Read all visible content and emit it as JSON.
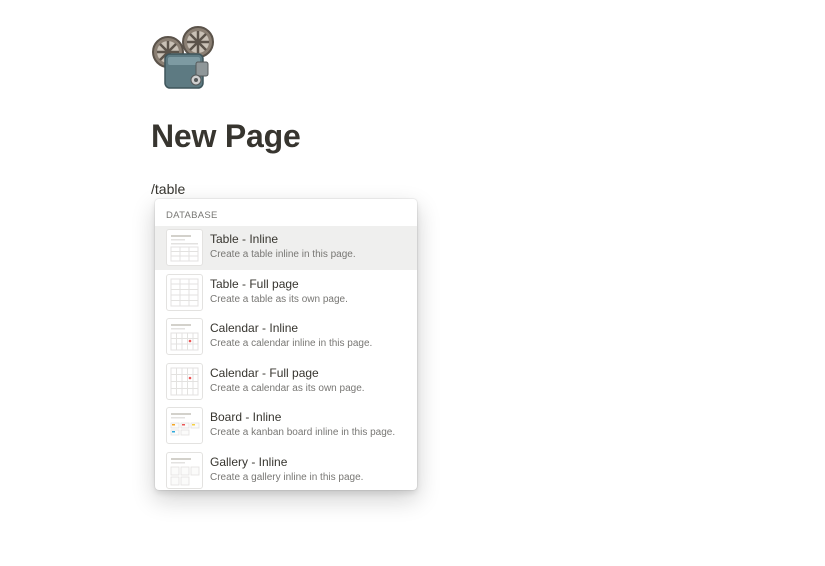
{
  "page": {
    "icon": "film-projector-icon",
    "title": "New Page",
    "editor_line": "/table"
  },
  "menu": {
    "section_label": "DATABASE",
    "items": [
      {
        "title": "Table - Inline",
        "description": "Create a table inline in this page.",
        "icon": "table-inline-thumbnail",
        "selected": true
      },
      {
        "title": "Table - Full page",
        "description": "Create a table as its own page.",
        "icon": "table-full-page-thumbnail",
        "selected": false
      },
      {
        "title": "Calendar - Inline",
        "description": "Create a calendar inline in this page.",
        "icon": "calendar-inline-thumbnail",
        "selected": false
      },
      {
        "title": "Calendar - Full page",
        "description": "Create a calendar as its own page.",
        "icon": "calendar-full-page-thumbnail",
        "selected": false
      },
      {
        "title": "Board - Inline",
        "description": "Create a kanban board inline in this page.",
        "icon": "board-inline-thumbnail",
        "selected": false
      },
      {
        "title": "Gallery - Inline",
        "description": "Create a gallery inline in this page.",
        "icon": "gallery-inline-thumbnail",
        "selected": false
      }
    ]
  },
  "colors": {
    "text": "#37352f",
    "muted": "#787774",
    "selected_bg": "#efefee",
    "calendar_dot": "#eb5757"
  }
}
